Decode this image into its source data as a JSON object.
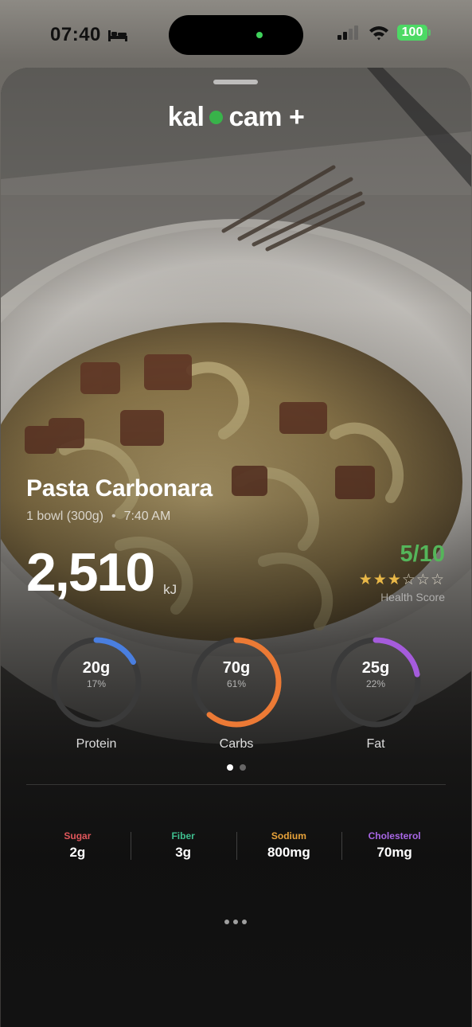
{
  "status_bar": {
    "time": "07:40",
    "battery": "100",
    "colors": {
      "battery": "#4cd964",
      "island_indicator": "#3fd15b"
    }
  },
  "app": {
    "brand_left": "kal",
    "brand_right": "cam +",
    "brand_dot_color": "#38b34a"
  },
  "meal": {
    "name": "Pasta Carbonara",
    "portion": "1 bowl (300g)",
    "separator": "•",
    "time": "7:40 AM",
    "energy_value": "2,510",
    "energy_unit": "kJ",
    "health_score": "5/10",
    "health_score_label": "Health Score",
    "stars_filled": 3,
    "stars_total": 6,
    "health_color": "#55b55a"
  },
  "macros": [
    {
      "name": "Protein",
      "grams": "20g",
      "percent": "17%",
      "fraction": 0.17,
      "color": "#4a7fe0"
    },
    {
      "name": "Carbs",
      "grams": "70g",
      "percent": "61%",
      "fraction": 0.61,
      "color": "#ec7a35"
    },
    {
      "name": "Fat",
      "grams": "25g",
      "percent": "22%",
      "fraction": 0.22,
      "color": "#a55cdc"
    }
  ],
  "pager": {
    "pages": 2,
    "active": 0
  },
  "nutrients": [
    {
      "label": "Sugar",
      "value": "2g",
      "color": "#e0575b"
    },
    {
      "label": "Fiber",
      "value": "3g",
      "color": "#3fbf8f"
    },
    {
      "label": "Sodium",
      "value": "800mg",
      "color": "#e9a33a"
    },
    {
      "label": "Cholesterol",
      "value": "70mg",
      "color": "#a967e6"
    }
  ],
  "more_icon": "ellipsis-icon"
}
